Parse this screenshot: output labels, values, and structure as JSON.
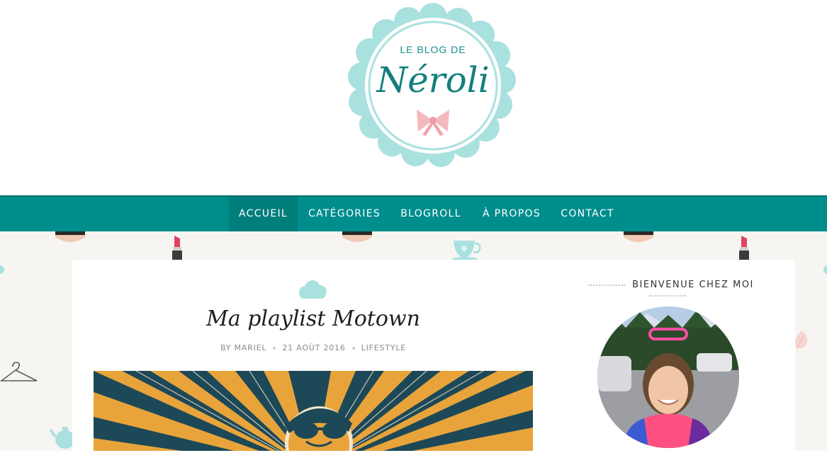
{
  "header": {
    "logo_small": "LE BLOG DE",
    "logo_main": "Néroli"
  },
  "nav": {
    "items": [
      {
        "label": "ACCUEIL",
        "active": true
      },
      {
        "label": "CATÉGORIES",
        "active": false
      },
      {
        "label": "BLOGROLL",
        "active": false
      },
      {
        "label": "À PROPOS",
        "active": false
      },
      {
        "label": "CONTACT",
        "active": false
      }
    ]
  },
  "post": {
    "title": "Ma playlist Motown",
    "author": "BY MARIEL",
    "date": "21 AOÛT 2016",
    "category": "LIFESTYLE"
  },
  "sidebar": {
    "widget_title": "BIENVENUE CHEZ MOI"
  },
  "colors": {
    "brand_teal": "#008e8d",
    "logo_scallop": "#a9e1df",
    "background": "#f7f5f2"
  },
  "icons": [
    "cloud-icon",
    "bow-icon",
    "lipstick-icon",
    "teacup-icon",
    "hanger-icon",
    "teapot-icon",
    "leaf-icon",
    "makeup-compact-icon"
  ]
}
